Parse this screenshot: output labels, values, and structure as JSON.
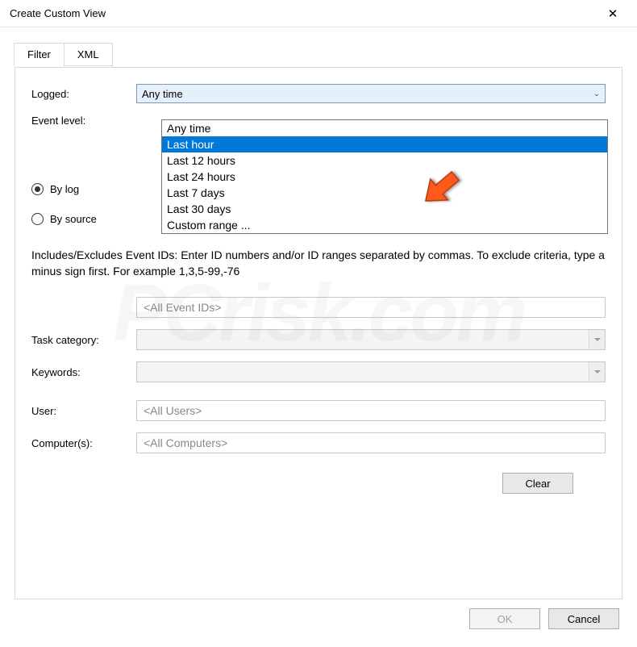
{
  "window": {
    "title": "Create Custom View",
    "close_symbol": "✕"
  },
  "tabs": {
    "filter": "Filter",
    "xml": "XML"
  },
  "labels": {
    "logged": "Logged:",
    "event_level": "Event level:",
    "by_log": "By log",
    "by_source": "By source",
    "task_category": "Task category:",
    "keywords": "Keywords:",
    "user": "User:",
    "computers": "Computer(s):"
  },
  "logged_combo": {
    "value": "Any time",
    "options": [
      "Any time",
      "Last hour",
      "Last 12 hours",
      "Last 24 hours",
      "Last 7 days",
      "Last 30 days",
      "Custom range ..."
    ],
    "selected_index": 1
  },
  "description": "Includes/Excludes Event IDs: Enter ID numbers and/or ID ranges separated by commas. To exclude criteria, type a minus sign first. For example 1,3,5-99,-76",
  "placeholders": {
    "event_ids": "<All Event IDs>",
    "user": "<All Users>",
    "computers": "<All Computers>"
  },
  "buttons": {
    "clear": "Clear",
    "ok": "OK",
    "cancel": "Cancel"
  },
  "watermark": "PCrisk.com"
}
